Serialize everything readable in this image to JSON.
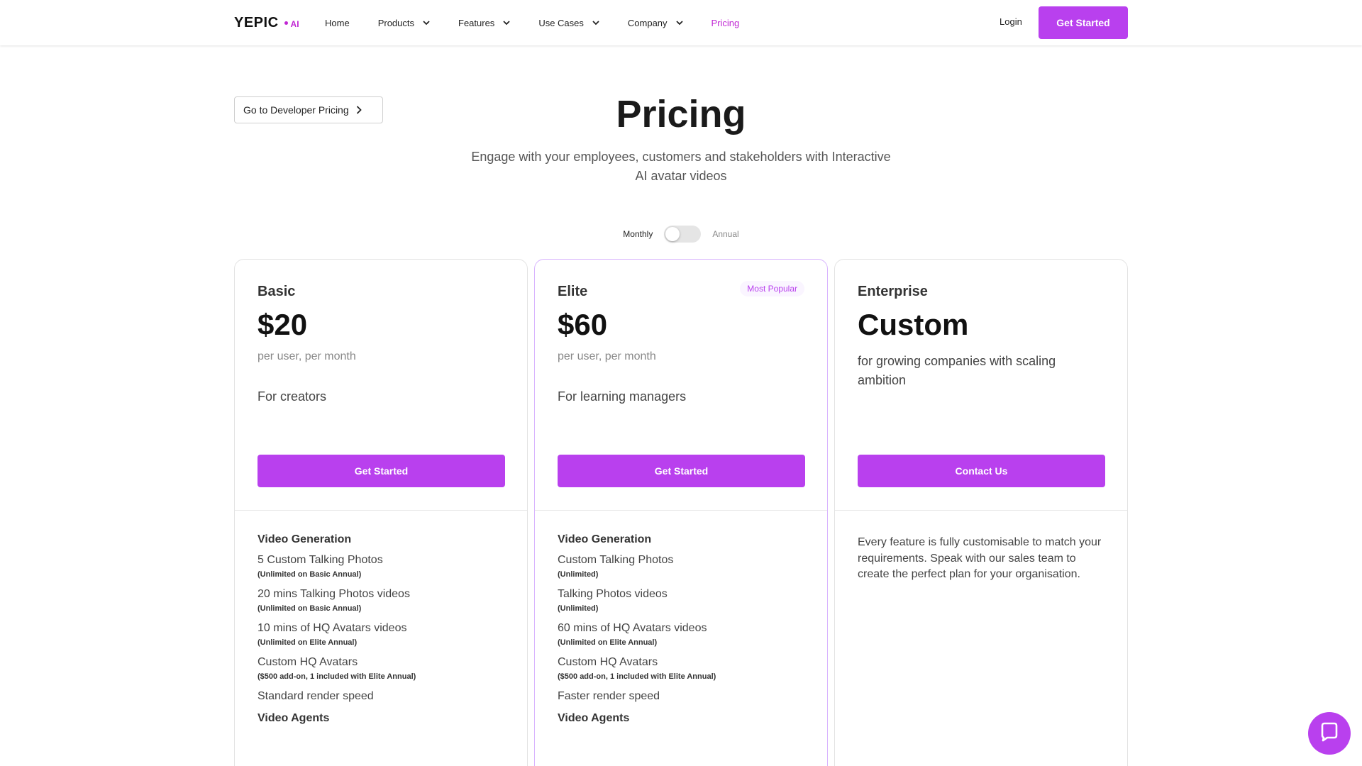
{
  "nav": {
    "logo": "YEPIC",
    "logo_suffix": "AI",
    "items": [
      {
        "label": "Home",
        "dropdown": false
      },
      {
        "label": "Products",
        "dropdown": true
      },
      {
        "label": "Features",
        "dropdown": true
      },
      {
        "label": "Use Cases",
        "dropdown": true
      },
      {
        "label": "Company",
        "dropdown": true
      },
      {
        "label": "Pricing",
        "dropdown": false,
        "active": true
      }
    ],
    "login": "Login",
    "cta": "Get Started"
  },
  "hero": {
    "dev_button": "Go to Developer Pricing",
    "title": "Pricing",
    "subtitle": "Engage with your employees, customers and stakeholders with Interactive AI avatar videos"
  },
  "billing": {
    "monthly": "Monthly",
    "annual": "Annual",
    "annual_selected": false
  },
  "plans": {
    "basic": {
      "name": "Basic",
      "price": "$20",
      "per": "per user, per month",
      "audience": "For creators",
      "button": "Get Started",
      "section1": "Video Generation",
      "features": [
        {
          "main": "5 Custom Talking Photos",
          "note": "(Unlimited on Basic Annual)"
        },
        {
          "main": "20 mins Talking Photos videos",
          "note": "(Unlimited on Basic Annual)"
        },
        {
          "main": "10 mins of HQ Avatars videos",
          "note": "(Unlimited on Elite Annual)"
        },
        {
          "main": "Custom HQ Avatars",
          "note": "($500 add-on, 1 included with Elite Annual)"
        },
        {
          "main": "Standard render speed"
        }
      ],
      "section2": "Video Agents"
    },
    "elite": {
      "name": "Elite",
      "badge": "Most Popular",
      "price": "$60",
      "per": "per user, per month",
      "audience": "For learning managers",
      "button": "Get Started",
      "section1": "Video Generation",
      "features": [
        {
          "main": "Custom Talking Photos",
          "note": "(Unlimited)"
        },
        {
          "main": "Talking Photos videos",
          "note": "(Unlimited)"
        },
        {
          "main": "60 mins of HQ Avatars videos",
          "note": "(Unlimited on Elite Annual)"
        },
        {
          "main": "Custom HQ Avatars",
          "note": "($500 add-on, 1 included with Elite Annual)"
        },
        {
          "main": "Faster render speed"
        }
      ],
      "section2": "Video Agents"
    },
    "enterprise": {
      "name": "Enterprise",
      "price": "Custom",
      "description": "for growing companies with scaling ambition",
      "button": "Contact Us",
      "features_text": "Every feature is fully customisable to match your requirements. Speak with our sales team to create the perfect plan for your organisation."
    }
  },
  "icons": {
    "chevron": "chevron-down-icon",
    "chevron_right": "chevron-right-icon",
    "chat": "chat-bubble-icon"
  },
  "colors": {
    "accent": "#b940ee",
    "accent_text": "#c026d3",
    "elite_border": "#d8b4fe"
  }
}
